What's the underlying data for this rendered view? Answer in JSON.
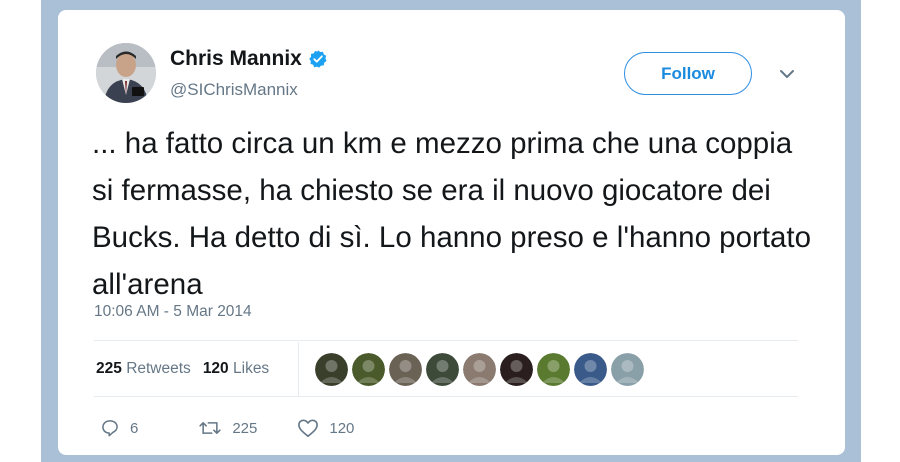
{
  "author": {
    "name": "Chris Mannix",
    "handle": "@SIChrisMannix",
    "verified": true
  },
  "follow_label": "Follow",
  "tweet_text": "... ha fatto circa un km e mezzo prima che una coppia si fermasse, ha chiesto se era il nuovo giocatore dei Bucks. Ha detto di sì. Lo hanno preso e l'hanno portato all'arena",
  "timestamp": "10:06 AM - 5 Mar 2014",
  "stats": {
    "retweets_count": "225",
    "retweets_label": "Retweets",
    "likes_count": "120",
    "likes_label": "Likes"
  },
  "liker_avatars": [
    {
      "color": "#3a3f2c"
    },
    {
      "color": "#4a5a2a"
    },
    {
      "color": "#6b6256"
    },
    {
      "color": "#3d4a3a"
    },
    {
      "color": "#8a7a70"
    },
    {
      "color": "#2a1e1e"
    },
    {
      "color": "#5a7a30"
    },
    {
      "color": "#3a5a8a"
    },
    {
      "color": "#8aa0a8"
    }
  ],
  "actions": {
    "reply_count": "6",
    "retweet_count": "225",
    "like_count": "120"
  },
  "colors": {
    "accent": "#1da1f2",
    "text": "#14171a",
    "muted": "#657786",
    "frame": "#a9c0d6"
  }
}
